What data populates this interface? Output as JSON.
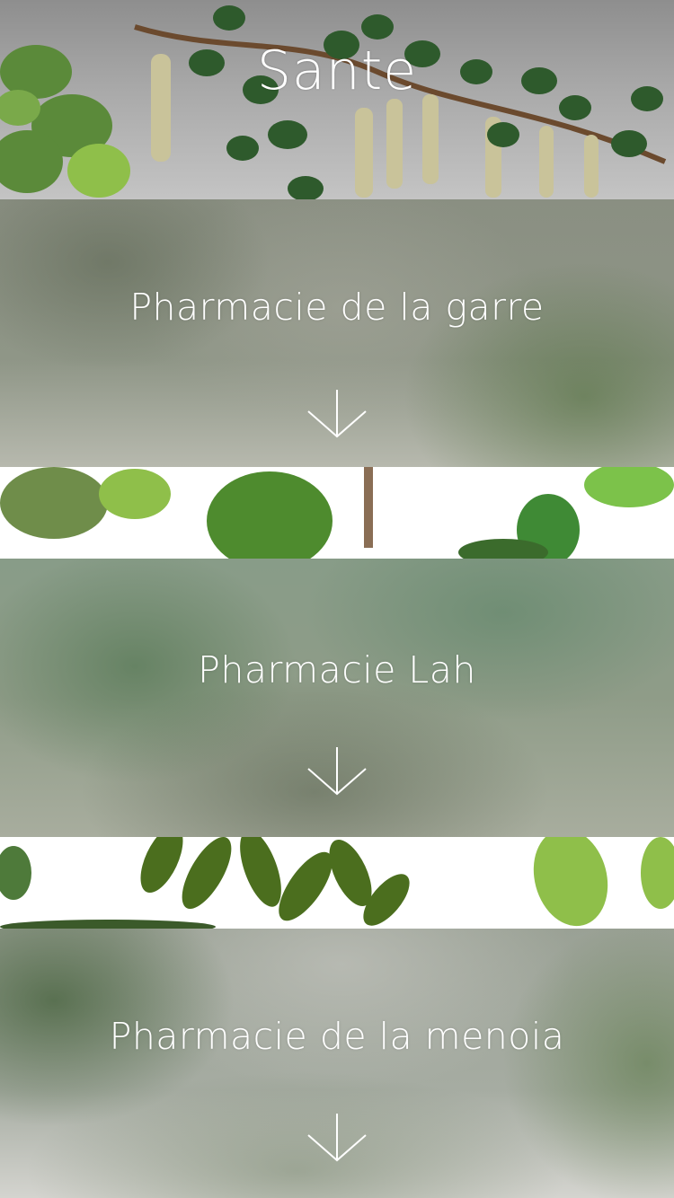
{
  "header": {
    "title": "Sante"
  },
  "pharmacies": [
    {
      "name": "Pharmacie de la garre",
      "arrow_icon": "arrow-down-icon"
    },
    {
      "name": "Pharmacie Lah",
      "arrow_icon": "arrow-down-icon"
    },
    {
      "name": "Pharmacie de la menoia",
      "arrow_icon": "arrow-down-icon"
    }
  ],
  "colors": {
    "text": "#ffffff",
    "leaf_dark": "#2e5a2c",
    "leaf_mid": "#4f7f3a",
    "leaf_light": "#8fbf4a",
    "blur_base": "#8c9a8a"
  }
}
